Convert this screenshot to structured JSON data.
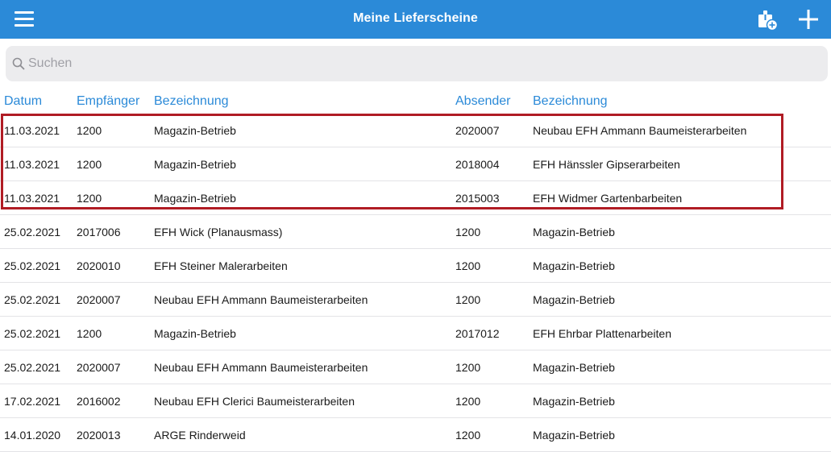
{
  "header": {
    "title": "Meine Lieferscheine",
    "menu_icon": "hamburger-menu-icon",
    "box_icon": "package-add-icon",
    "add_icon": "plus-icon",
    "bar_color": "#2b8ad8"
  },
  "search": {
    "placeholder": "Suchen",
    "value": ""
  },
  "table": {
    "columns": [
      "Datum",
      "Empfänger",
      "Bezeichnung",
      "Absender",
      "Bezeichnung"
    ],
    "rows": [
      [
        "11.03.2021",
        "1200",
        "Magazin-Betrieb",
        "2020007",
        "Neubau EFH Ammann Baumeisterarbeiten"
      ],
      [
        "11.03.2021",
        "1200",
        "Magazin-Betrieb",
        "2018004",
        "EFH Hänssler Gipserarbeiten"
      ],
      [
        "11.03.2021",
        "1200",
        "Magazin-Betrieb",
        "2015003",
        "EFH Widmer Gartenbarbeiten"
      ],
      [
        "25.02.2021",
        "2017006",
        "EFH Wick (Planausmass)",
        "1200",
        "Magazin-Betrieb"
      ],
      [
        "25.02.2021",
        "2020010",
        "EFH Steiner Malerarbeiten",
        "1200",
        "Magazin-Betrieb"
      ],
      [
        "25.02.2021",
        "2020007",
        "Neubau EFH Ammann Baumeisterarbeiten",
        "1200",
        "Magazin-Betrieb"
      ],
      [
        "25.02.2021",
        "1200",
        "Magazin-Betrieb",
        "2017012",
        "EFH Ehrbar Plattenarbeiten"
      ],
      [
        "25.02.2021",
        "2020007",
        "Neubau EFH Ammann Baumeisterarbeiten",
        "1200",
        "Magazin-Betrieb"
      ],
      [
        "17.02.2021",
        "2016002",
        "Neubau EFH Clerici Baumeisterarbeiten",
        "1200",
        "Magazin-Betrieb"
      ],
      [
        "14.01.2020",
        "2020013",
        "ARGE Rinderweid",
        "1200",
        "Magazin-Betrieb"
      ]
    ]
  },
  "highlight_color": "#b01c24"
}
